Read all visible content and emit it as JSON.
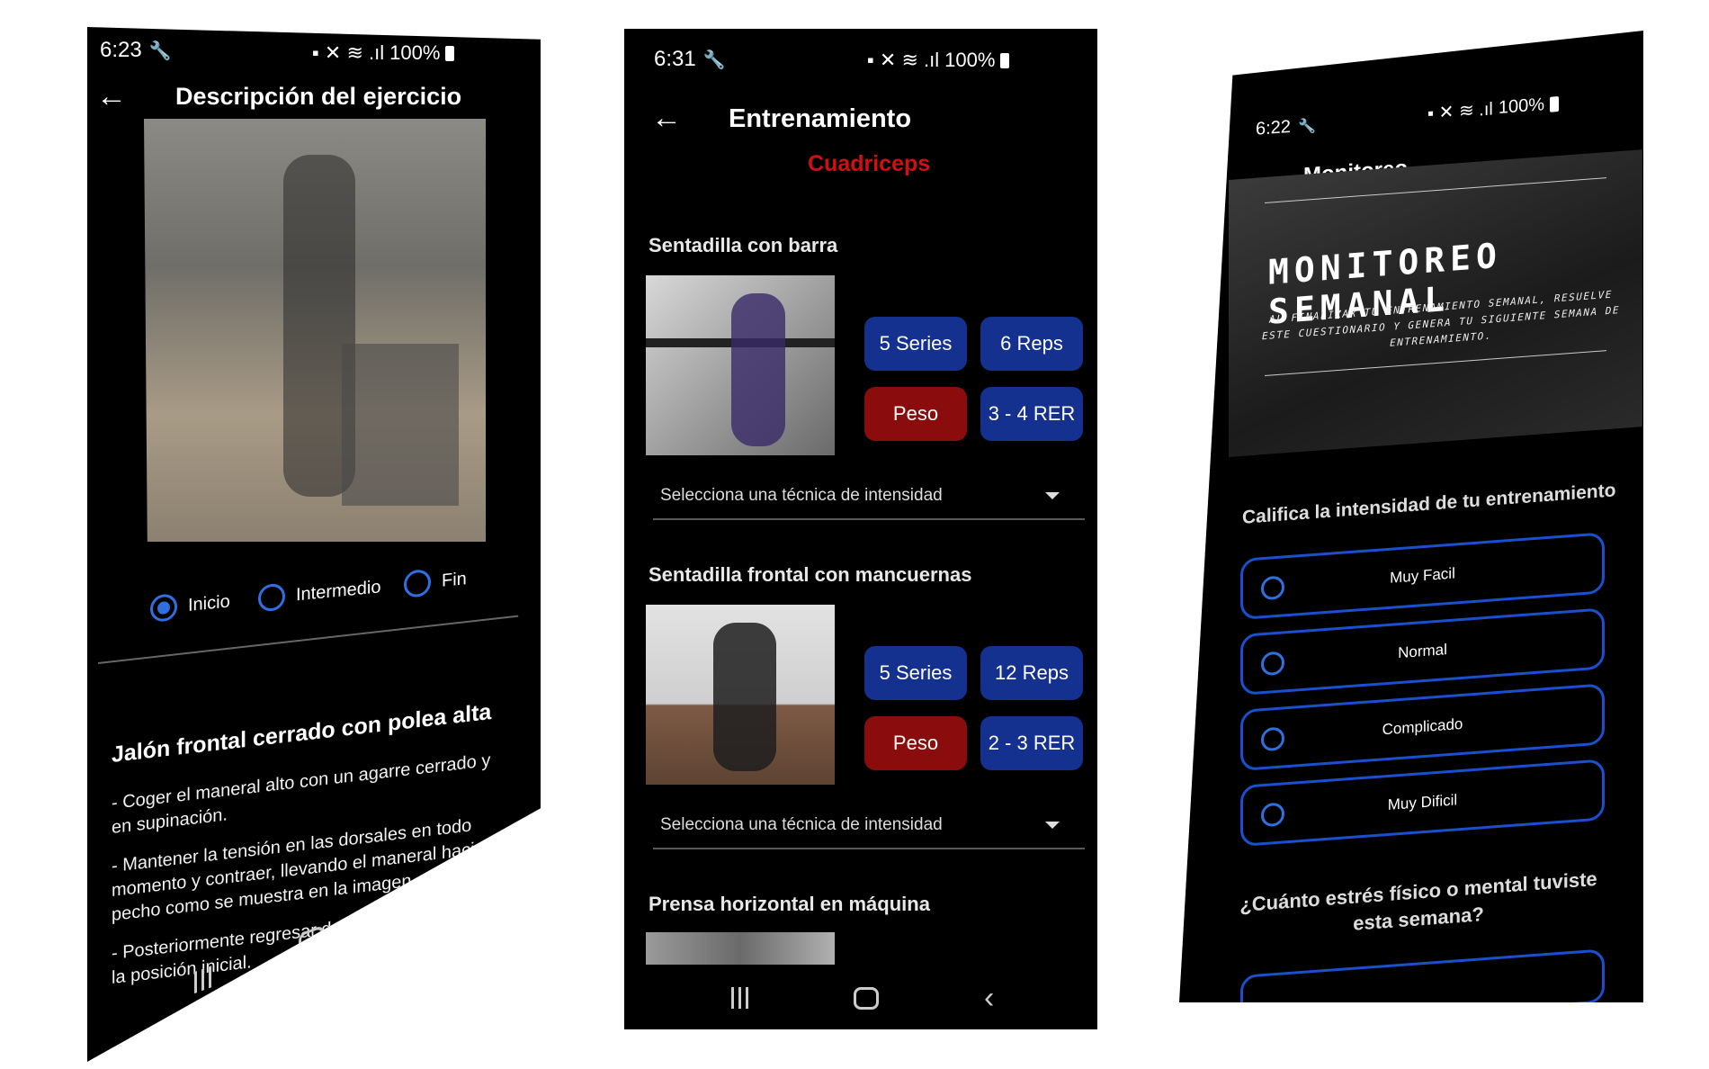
{
  "phone1": {
    "time": "6:23",
    "battery": "100%",
    "title": "Descripción del ejercicio",
    "radios": [
      {
        "label": "Inicio",
        "selected": true
      },
      {
        "label": "Intermedio",
        "selected": false
      },
      {
        "label": "Fin",
        "selected": false
      }
    ],
    "exercise_name": "Jalón frontal cerrado con polea alta",
    "steps": [
      "- Coger el maneral alto con un agarre cerrado y en supinación.",
      "- Mantener la tensión en las dorsales en todo momento y contraer, llevando el maneral hacia el pecho como se muestra en la imagen.",
      "- Posteriormente regresar de manera controlada a la posición inicial."
    ]
  },
  "phone2": {
    "time": "6:31",
    "battery": "100%",
    "title": "Entrenamiento",
    "subtitle": "Cuadriceps",
    "exercises": [
      {
        "name": "Sentadilla con barra",
        "series": "5 Series",
        "reps": "6 Reps",
        "weight": "Peso",
        "rer": "3 - 4 RER",
        "dropdown": "Selecciona una técnica de intensidad"
      },
      {
        "name": "Sentadilla frontal con mancuernas",
        "series": "5 Series",
        "reps": "12 Reps",
        "weight": "Peso",
        "rer": "2 - 3 RER",
        "dropdown": "Selecciona una técnica de intensidad"
      },
      {
        "name": "Prensa horizontal en máquina"
      }
    ]
  },
  "phone3": {
    "time": "6:22",
    "battery": "100%",
    "title": "Monitoreo",
    "banner_title": "MONITOREO SEMANAL",
    "banner_text": "AL FINALIZAR TU ENTRENAMIENTO SEMANAL, RESUELVE ESTE CUESTIONARIO Y GENERA TU SIGUIENTE SEMANA DE ENTRENAMIENTO.",
    "question1": "Califica la intensidad de tu entrenamiento",
    "options": [
      "Muy Facil",
      "Normal",
      "Complicado",
      "Muy Dificil"
    ],
    "question2": "¿Cuánto estrés físico o mental tuviste esta semana?"
  },
  "colors": {
    "background": "#000000",
    "accent_blue": "#15318f",
    "accent_red": "#8a0c0c",
    "radio_blue": "#2f6fe0",
    "title_red": "#d01010"
  }
}
